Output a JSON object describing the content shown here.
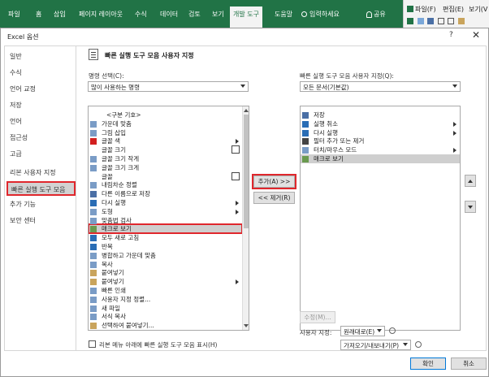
{
  "ribbon": {
    "tabs": [
      "파일",
      "홈",
      "삽입",
      "페이지 레이아웃",
      "수식",
      "데이터",
      "검토",
      "보기",
      "개발 도구",
      "도움말",
      "입력하세요"
    ],
    "active_tab": "개발 도구",
    "share": "공유",
    "right": {
      "file_label": "파일(F)",
      "edit_label": "편집(E)",
      "view_label": "보기(V"
    }
  },
  "dialog": {
    "title": "Excel 옵션",
    "help": "?",
    "close": "✕"
  },
  "nav": {
    "items": [
      "일반",
      "수식",
      "언어 교정",
      "저장",
      "언어",
      "접근성",
      "고급",
      "리본 사용자 지정",
      "빠른 실행 도구 모음",
      "추가 기능",
      "보안 센터"
    ],
    "selected": "빠른 실행 도구 모음"
  },
  "content": {
    "header": "빠른 실행 도구 모음 사용자 지정",
    "choose_label": "명령 선택(C):",
    "choose_value": "많이 사용하는 명령",
    "customize_label": "빠른 실행 도구 모음 사용자 지정(Q):",
    "customize_value": "모든 문서(기본값)",
    "left_list": [
      {
        "label": "<구분 기호>",
        "icon": "",
        "sub": "",
        "sel": false
      },
      {
        "label": "가운데 맞춤",
        "icon": "align-center-icon",
        "sub": "",
        "sel": false
      },
      {
        "label": "그림 삽입",
        "icon": "picture-icon",
        "sub": "",
        "sel": false
      },
      {
        "label": "글꼴 색",
        "icon": "font-color-icon",
        "sub": "arrow",
        "sel": false
      },
      {
        "label": "글꼴 크기",
        "icon": "",
        "sub": "box",
        "sel": false
      },
      {
        "label": "글꼴 크기 작게",
        "icon": "font-smaller-icon",
        "sub": "",
        "sel": false
      },
      {
        "label": "글꼴 크기 크게",
        "icon": "font-bigger-icon",
        "sub": "",
        "sel": false
      },
      {
        "label": "글꼴",
        "icon": "",
        "sub": "box",
        "sel": false
      },
      {
        "label": "내림차순 정렬",
        "icon": "sort-desc-icon",
        "sub": "",
        "sel": false
      },
      {
        "label": "다른 이름으로 저장",
        "icon": "save-as-icon",
        "sub": "",
        "sel": false
      },
      {
        "label": "다시 실행",
        "icon": "redo-icon",
        "sub": "arrow",
        "sel": false
      },
      {
        "label": "도형",
        "icon": "shapes-icon",
        "sub": "arrow",
        "sel": false
      },
      {
        "label": "맞춤법 검사",
        "icon": "spellcheck-icon",
        "sub": "",
        "sel": false
      },
      {
        "label": "매크로 보기",
        "icon": "macro-icon",
        "sub": "",
        "sel": true
      },
      {
        "label": "모두 새로 고침",
        "icon": "refresh-icon",
        "sub": "",
        "sel": false
      },
      {
        "label": "반복",
        "icon": "repeat-icon",
        "sub": "",
        "sel": false
      },
      {
        "label": "병합하고 가운데 맞춤",
        "icon": "merge-icon",
        "sub": "",
        "sel": false
      },
      {
        "label": "복사",
        "icon": "copy-icon",
        "sub": "",
        "sel": false
      },
      {
        "label": "붙여넣기",
        "icon": "paste-icon",
        "sub": "",
        "sel": false
      },
      {
        "label": "붙여넣기",
        "icon": "paste-icon",
        "sub": "arrow",
        "sel": false
      },
      {
        "label": "빠른 인쇄",
        "icon": "quick-print-icon",
        "sub": "",
        "sel": false
      },
      {
        "label": "사용자 지정 정렬...",
        "icon": "custom-sort-icon",
        "sub": "",
        "sel": false
      },
      {
        "label": "새 파일",
        "icon": "new-file-icon",
        "sub": "",
        "sel": false
      },
      {
        "label": "서식 복사",
        "icon": "format-painter-icon",
        "sub": "",
        "sel": false
      },
      {
        "label": "선택하여 붙여넣기...",
        "icon": "paste-special-icon",
        "sub": "",
        "sel": false
      }
    ],
    "right_list": [
      {
        "label": "저장",
        "icon": "save-icon",
        "sub": "",
        "sel": false
      },
      {
        "label": "실행 취소",
        "icon": "undo-icon",
        "sub": "arrow",
        "sel": false
      },
      {
        "label": "다시 실행",
        "icon": "redo-icon",
        "sub": "arrow",
        "sel": false
      },
      {
        "label": "필터 추가 또는 제거",
        "icon": "filter-icon",
        "sub": "",
        "sel": false
      },
      {
        "label": "터치/마우스 모드",
        "icon": "touch-icon",
        "sub": "arrow",
        "sel": false
      },
      {
        "label": "매크로 보기",
        "icon": "macro-view-icon",
        "sub": "",
        "sel": true
      }
    ],
    "add_button": "추가(A) >>",
    "remove_button": "<< 제거(R)",
    "modify_button": "수정(M)...",
    "customize_label2": "사용자 지정:",
    "reset_button": "원래대로(E)",
    "import_export_button": "가져오기/내보내기(P)",
    "show_below_ribbon": "리본 메뉴 아래에 빠른 실행 도구 모음 표시(H)",
    "ok_button": "확인",
    "cancel_button": "취소"
  }
}
